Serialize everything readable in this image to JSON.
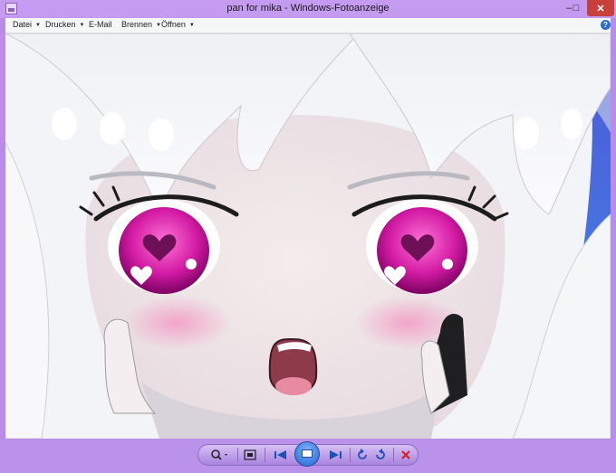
{
  "window": {
    "title": "pan for mika - Windows-Fotoanzeige",
    "controls": {
      "minimize": "–",
      "maximize": "□",
      "close": "✕"
    }
  },
  "menu": [
    {
      "label": "Datei",
      "has_dropdown": true
    },
    {
      "label": "Drucken",
      "has_dropdown": true
    },
    {
      "label": "E-Mail",
      "has_dropdown": false
    },
    {
      "label": "Brennen",
      "has_dropdown": true
    },
    {
      "label": "Öffnen",
      "has_dropdown": true
    }
  ],
  "help": {
    "label": "?"
  },
  "image": {
    "icon": "anime-portrait-image"
  },
  "toolbar": {
    "zoom_icon": "zoom-icon",
    "actual_size_icon": "fit-window-icon",
    "previous_icon": "previous-icon",
    "slideshow_icon": "slideshow-icon",
    "next_icon": "next-icon",
    "rotate_left_icon": "rotate-counterclockwise-icon",
    "rotate_right_icon": "rotate-clockwise-icon",
    "delete_icon": "delete-icon"
  },
  "colors": {
    "frame": "#b98ce8",
    "menu_bg": "#f5f6f7",
    "close_button": "#c7403a",
    "slideshow_button": "#1d5fd0",
    "delete": "#d22020"
  }
}
